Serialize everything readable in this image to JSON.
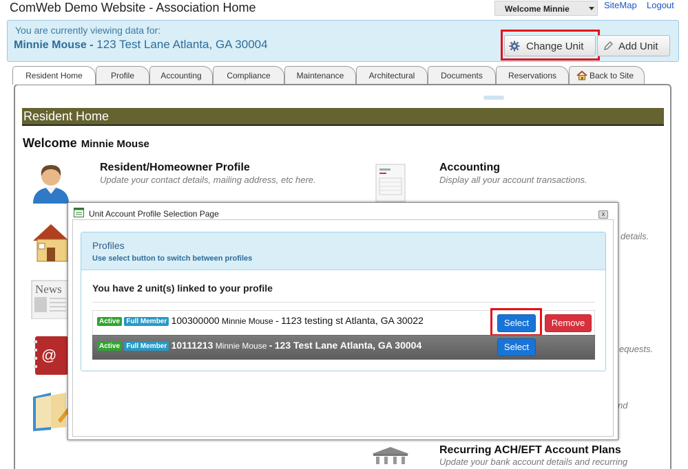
{
  "header": {
    "site_title": "ComWeb Demo Website - Association Home",
    "welcome_label": "Welcome",
    "welcome_user": "Minnie",
    "sitemap": "SiteMap",
    "logout": "Logout"
  },
  "unit_bar": {
    "viewing_label": "You are currently viewing data for:",
    "owner": "Minnie Mouse -",
    "address": "123 Test Lane Atlanta, GA 30004",
    "change_unit": "Change Unit",
    "add_unit": "Add Unit"
  },
  "tabs": [
    "Resident Home",
    "Profile",
    "Accounting",
    "Compliance",
    "Maintenance",
    "Architectural",
    "Documents",
    "Reservations",
    "Back to Site"
  ],
  "main": {
    "section_title": "Resident Home",
    "welcome_label": "Welcome",
    "welcome_name": "Minnie Mouse",
    "items": [
      {
        "title": "Resident/Homeowner Profile",
        "desc": "Update your contact details, mailing address, etc here."
      },
      {
        "title": "Accounting",
        "desc": "Display all your account transactions."
      },
      {
        "title": "Recurring ACH/EFT Account Plans",
        "desc": "Update your bank account details and recurring"
      }
    ],
    "fragments": [
      "details.",
      "equests.",
      "nd"
    ]
  },
  "modal": {
    "title": "Unit Account Profile Selection Page",
    "close": "x",
    "panel_title": "Profiles",
    "panel_subtitle": "Use select button to switch between profiles",
    "linked_text": "You have 2 unit(s) linked to your profile",
    "units": [
      {
        "status": "Active",
        "membership": "Full Member",
        "account": "100300000",
        "name": "Minnie Mouse",
        "sep": "-",
        "address": "1123 testing st Atlanta, GA 30022",
        "select": "Select",
        "remove": "Remove"
      },
      {
        "status": "Active",
        "membership": "Full Member",
        "account": "10111213",
        "name": "Minnie Mouse",
        "sep": "-",
        "address": "123 Test Lane Atlanta, GA 30004",
        "select": "Select"
      }
    ]
  },
  "colors": {
    "accent_blue": "#1a74d6",
    "remove_red": "#d7313e",
    "highlight_red": "#e4111b",
    "section_bar": "#65632f",
    "unit_bar_bg": "#d9eef7"
  }
}
